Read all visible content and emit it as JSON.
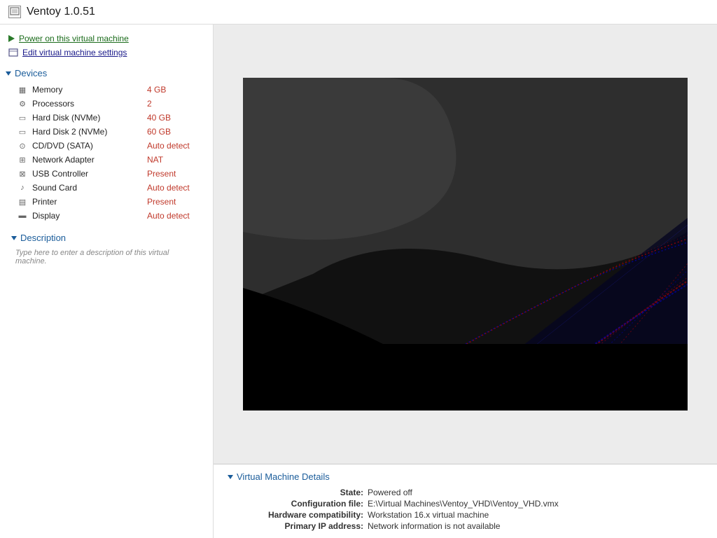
{
  "window": {
    "title": "Ventoy 1.0.51",
    "icon_label": "VM"
  },
  "actions": {
    "power_on": "Power on this virtual machine",
    "edit_settings": "Edit virtual machine settings"
  },
  "devices_section": {
    "label": "Devices",
    "items": [
      {
        "name": "Memory",
        "value": "4 GB",
        "icon": "memory"
      },
      {
        "name": "Processors",
        "value": "2",
        "icon": "cpu"
      },
      {
        "name": "Hard Disk (NVMe)",
        "value": "40 GB",
        "icon": "disk"
      },
      {
        "name": "Hard Disk 2 (NVMe)",
        "value": "60 GB",
        "icon": "disk"
      },
      {
        "name": "CD/DVD (SATA)",
        "value": "Auto detect",
        "icon": "cdrom"
      },
      {
        "name": "Network Adapter",
        "value": "NAT",
        "icon": "network"
      },
      {
        "name": "USB Controller",
        "value": "Present",
        "icon": "usb"
      },
      {
        "name": "Sound Card",
        "value": "Auto detect",
        "icon": "sound"
      },
      {
        "name": "Printer",
        "value": "Present",
        "icon": "printer"
      },
      {
        "name": "Display",
        "value": "Auto detect",
        "icon": "display"
      }
    ]
  },
  "description_section": {
    "label": "Description",
    "placeholder": "Type here to enter a description of this virtual machine."
  },
  "vm_details": {
    "header": "Virtual Machine Details",
    "rows": [
      {
        "label": "State:",
        "value": "Powered off"
      },
      {
        "label": "Configuration file:",
        "value": "E:\\Virtual Machines\\Ventoy_VHD\\Ventoy_VHD.vmx"
      },
      {
        "label": "Hardware compatibility:",
        "value": "Workstation 16.x virtual machine"
      },
      {
        "label": "Primary IP address:",
        "value": "Network information is not available"
      }
    ]
  }
}
